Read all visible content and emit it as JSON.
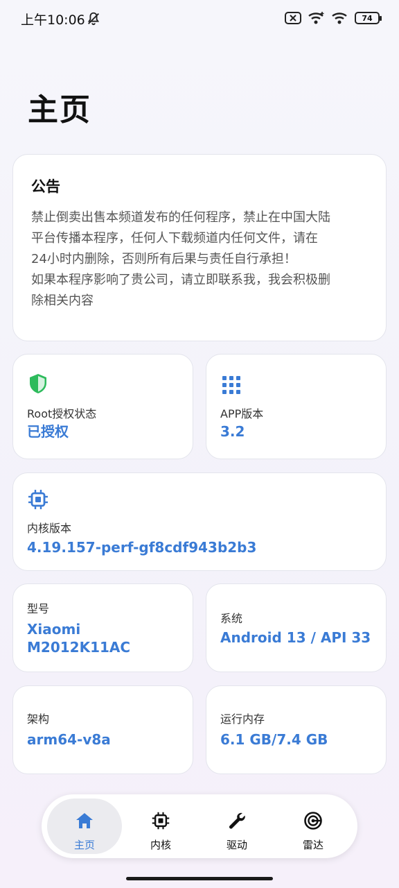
{
  "status_bar": {
    "time": "上午10:06",
    "battery": "74",
    "icons": [
      "bell-off-icon",
      "sim-error-icon",
      "wifi-icon",
      "wifi-icon",
      "battery-icon"
    ]
  },
  "page": {
    "title": "主页"
  },
  "notice": {
    "title": "公告",
    "lines": [
      "禁止倒卖出售本频道发布的任何程序，禁止在中国大陆",
      "平台传播本程序，任何人下载频道内任何文件，请在",
      "24小时内删除，否则所有后果与责任自行承担！",
      "如果本程序影响了贵公司，请立即联系我，我会积极删",
      "除相关内容"
    ]
  },
  "cards": {
    "root": {
      "label": "Root授权状态",
      "value": "已授权",
      "icon": "shield-check-icon"
    },
    "app": {
      "label": "APP版本",
      "value": "3.2",
      "icon": "apps-grid-icon"
    },
    "kernel": {
      "label": "内核版本",
      "value": "4.19.157-perf-gf8cdf943b2b3",
      "icon": "chip-icon"
    },
    "model": {
      "label": "型号",
      "value_line1": "Xiaomi",
      "value_line2": "M2012K11AC"
    },
    "system": {
      "label": "系统",
      "value": "Android 13 / API 33"
    },
    "arch": {
      "label": "架构",
      "value": "arm64-v8a"
    },
    "memory": {
      "label": "运行内存",
      "value": "6.1 GB/7.4 GB"
    }
  },
  "nav": {
    "items": [
      {
        "label": "主页",
        "icon": "home-icon",
        "active": true
      },
      {
        "label": "内核",
        "icon": "chip-icon",
        "active": false
      },
      {
        "label": "驱动",
        "icon": "wrench-icon",
        "active": false
      },
      {
        "label": "雷达",
        "icon": "radar-icon",
        "active": false
      }
    ]
  },
  "colors": {
    "accent": "#3a7bd5",
    "shield": "#2dbb5c",
    "background": "#f5f4fa"
  }
}
